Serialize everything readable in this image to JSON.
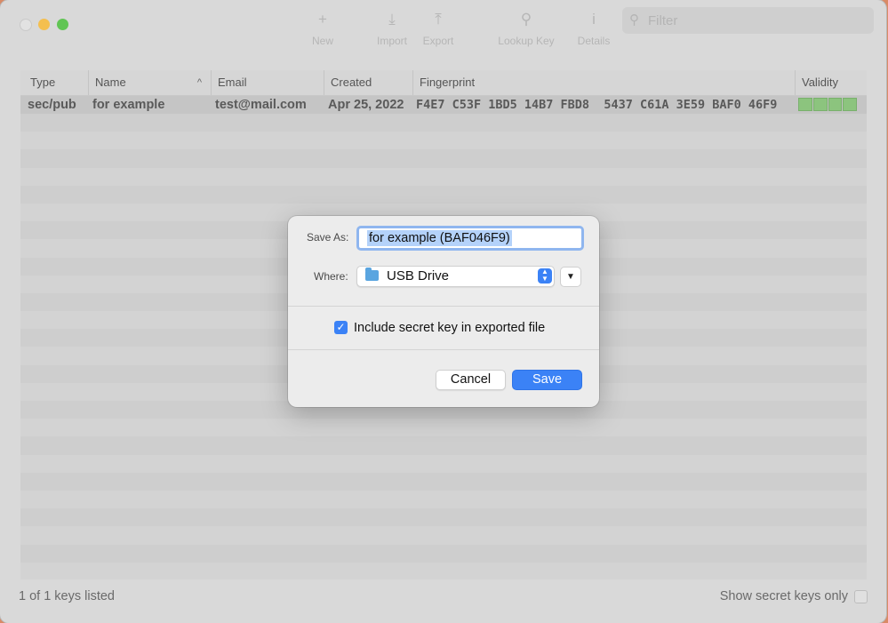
{
  "toolbar": {
    "new_label": "New",
    "import_label": "Import",
    "export_label": "Export",
    "lookup_label": "Lookup Key",
    "details_label": "Details",
    "filter_placeholder": "Filter"
  },
  "table": {
    "columns": [
      "Type",
      "Name",
      "Email",
      "Created",
      "Fingerprint",
      "Validity"
    ],
    "rows": [
      {
        "type": "sec/pub",
        "name": "for example",
        "email": "test@mail.com",
        "created": "Apr 25, 2022",
        "fingerprint": "F4E7 C53F 1BD5 14B7 FBD8  5437 C61A 3E59 BAF0 46F9",
        "validity_color": "#8cc47e"
      }
    ]
  },
  "footer": {
    "count": "1 of 1 keys listed",
    "secret_only_label": "Show secret keys only"
  },
  "dialog": {
    "save_as_label": "Save As:",
    "save_as_value": "for example (BAF046F9)",
    "where_label": "Where:",
    "where_value": "USB Drive",
    "include_secret_label": "Include secret key in exported file",
    "include_secret_checked": true,
    "cancel_label": "Cancel",
    "save_label": "Save"
  },
  "colors": {
    "accent": "#3b82f6",
    "desktop": "#d98a66"
  }
}
